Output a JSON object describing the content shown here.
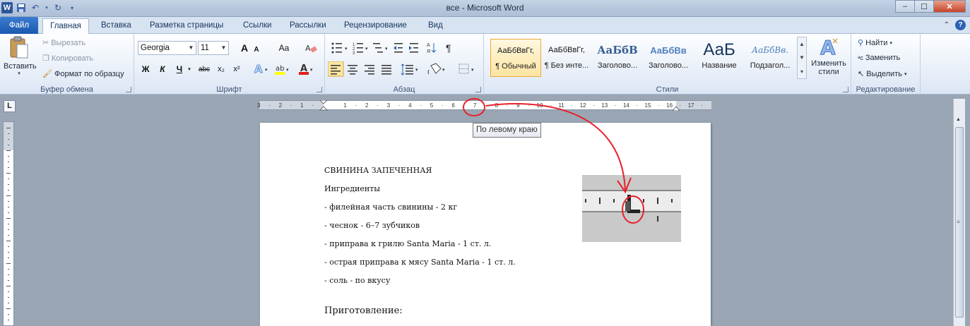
{
  "window": {
    "title": "все  -  Microsoft Word",
    "minimize": "–",
    "maximize": "☐",
    "close": "✕"
  },
  "qat": {
    "word": "W"
  },
  "tabs": {
    "file": "Файл",
    "home": "Главная",
    "insert": "Вставка",
    "layout": "Разметка страницы",
    "references": "Ссылки",
    "mailings": "Рассылки",
    "review": "Рецензирование",
    "view": "Вид"
  },
  "ribbon": {
    "clipboard": {
      "label": "Буфер обмена",
      "paste": "Вставить",
      "cut": "Вырезать",
      "copy": "Копировать",
      "format_painter": "Формат по образцу"
    },
    "font": {
      "label": "Шрифт",
      "font_name": "Georgia",
      "font_size": "11",
      "bold": "Ж",
      "italic": "К",
      "underline": "Ч",
      "strike": "abc",
      "sub": "x₂",
      "sup": "x²",
      "grow": "A",
      "shrink": "A",
      "case": "Aa"
    },
    "paragraph": {
      "label": "Абзац"
    },
    "styles": {
      "label": "Стили",
      "items": [
        {
          "preview": "АаБбВвГг,",
          "name": "¶ Обычный"
        },
        {
          "preview": "АаБбВвГг,",
          "name": "¶ Без инте..."
        },
        {
          "preview": "АаБбВ",
          "name": "Заголово..."
        },
        {
          "preview": "АаБбВв",
          "name": "Заголово..."
        },
        {
          "preview": "АаБ",
          "name": "Название"
        },
        {
          "preview": "АаБбВв.",
          "name": "Подзагол..."
        }
      ],
      "change_styles": "Изменить стили"
    },
    "editing": {
      "label": "Редактирование",
      "find": "Найти",
      "replace": "Заменить",
      "select": "Выделить"
    }
  },
  "ruler": {
    "tab_selector": "L",
    "ticks": [
      "3",
      "2",
      "1",
      "1",
      "2",
      "3",
      "4",
      "5",
      "6",
      "7",
      "8",
      "9",
      "10",
      "11",
      "12",
      "13",
      "14",
      "15",
      "16",
      "17"
    ]
  },
  "tooltip": "По левому краю",
  "document": {
    "lines": [
      "СВИНИНА ЗАПЕЧЕННАЯ",
      "Ингредиенты",
      "- филейная часть свинины - 2 кг",
      "- чеснок - 6–7 зубчиков",
      "- приправа к грилю Santa Maria - 1 ст. л.",
      "- острая приправа к мясу Santa Maria - 1 ст. л.",
      "- соль - по вкусу"
    ],
    "heading2": "Приготовление:"
  },
  "colors": {
    "accent_file_tab": "#2b62b6",
    "annotation": "#e8202a"
  }
}
